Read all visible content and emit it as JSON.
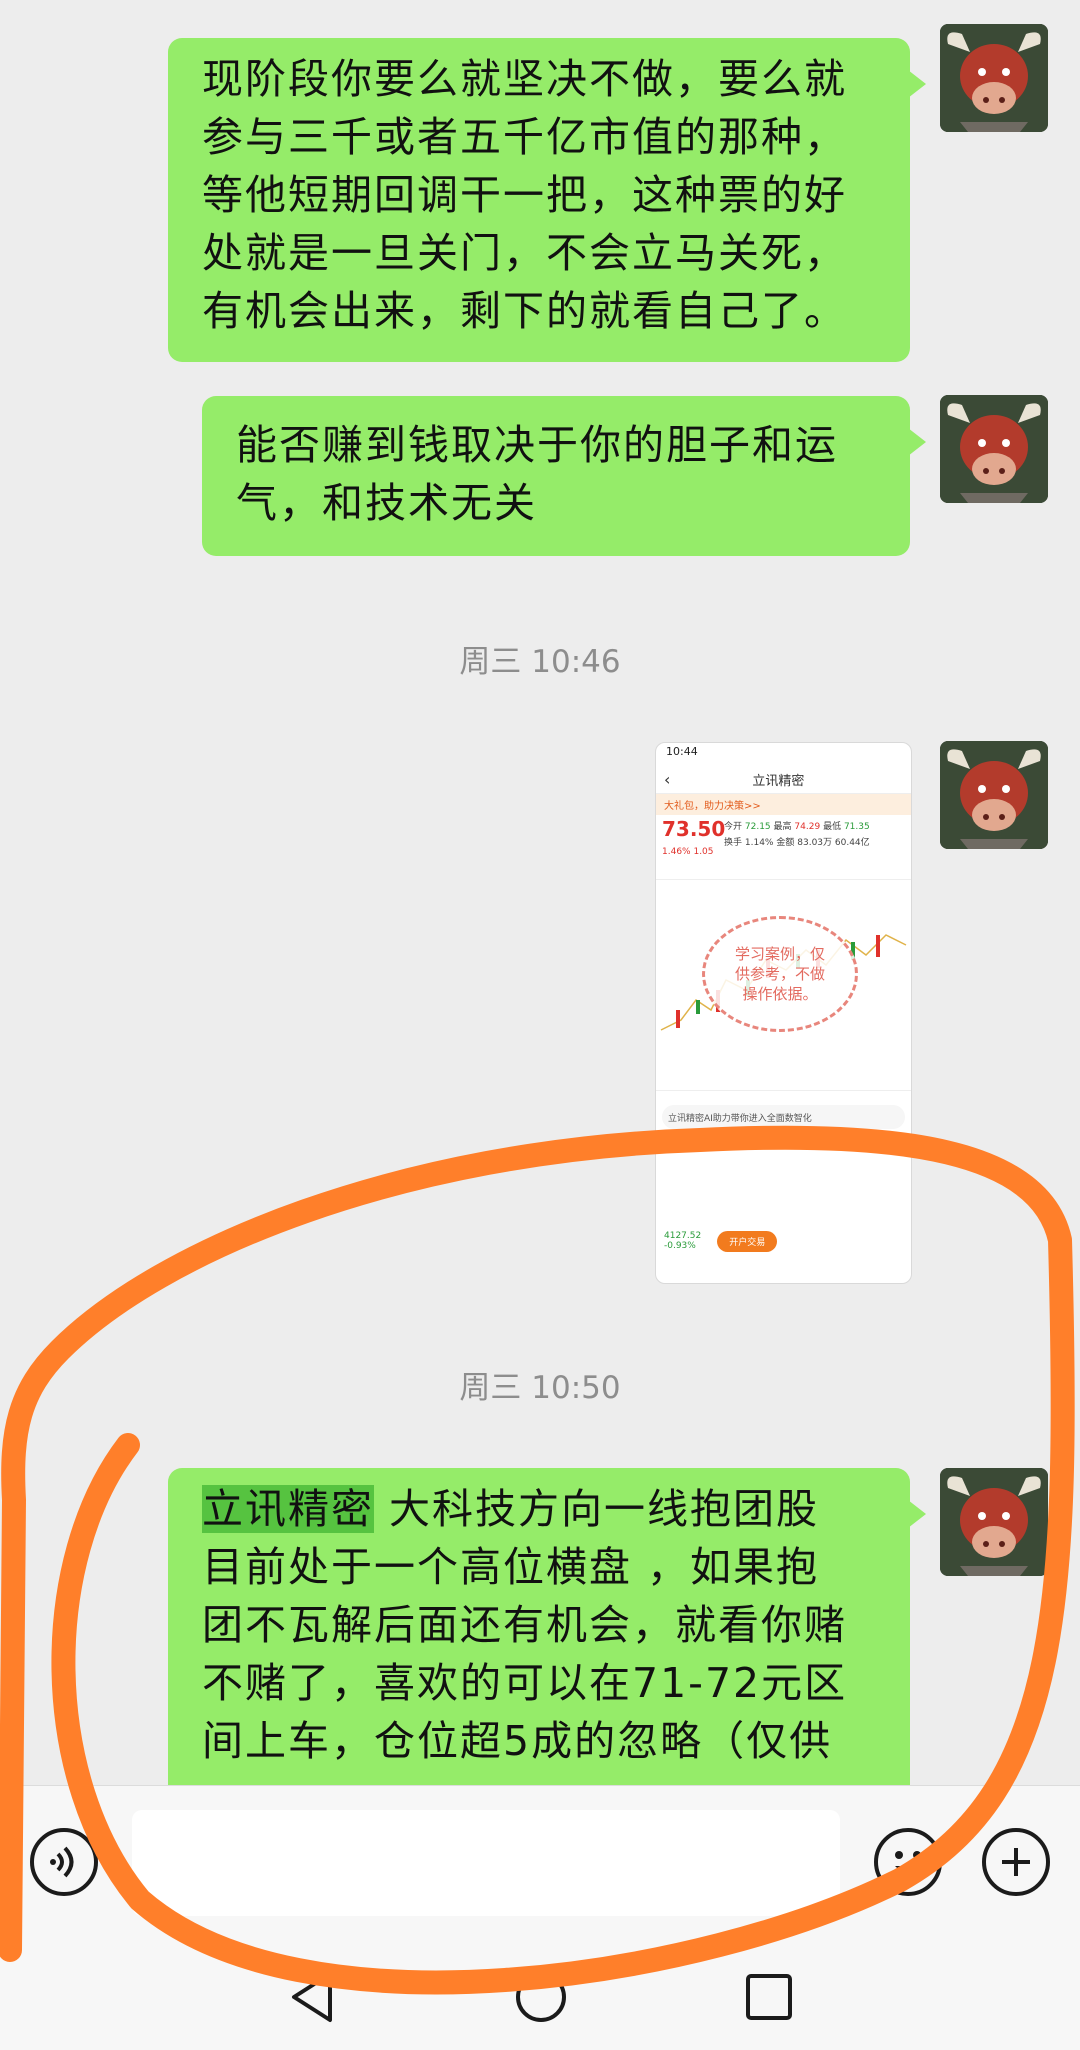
{
  "messages": [
    {
      "type": "text",
      "lines": [
        "现阶段你要么就坚决不做，要么就",
        "参与三千或者五千亿市值的那种，",
        "等他短期回调干一把，这种票的好",
        "处就是一旦关门，不会立马关死，",
        "有机会出来，剩下的就看自己了。"
      ]
    },
    {
      "type": "text",
      "lines": [
        "能否赚到钱取决于你的胆子和运",
        "气，和技术无关"
      ]
    },
    {
      "type": "time",
      "text": "周三 10:46"
    },
    {
      "type": "image",
      "screenshot": {
        "status_time": "10:44",
        "stock_name": "立讯精密",
        "banner": "大礼包，助力决策>>",
        "price": "73.50",
        "open_label": "今开",
        "open": "72.15",
        "high_label": "最高",
        "high": "74.29",
        "low_label": "最低",
        "low": "71.35",
        "change_pct": "1.46%",
        "change": "1.05",
        "turnover_label": "换手",
        "turnover": "1.14%",
        "volume_label": "金额",
        "volume": "83.03万",
        "amount": "60.44亿",
        "stamp": "学习案例，仅供参考，不做操作依据。",
        "ad": "立讯精密AI助力带你进入全面数智化",
        "index_value": "4127.52",
        "index_change": "-0.93%",
        "open_account": "开户交易"
      }
    },
    {
      "type": "time",
      "text": "周三 10:50"
    },
    {
      "type": "text",
      "highlight": "立讯精密",
      "lines": [
        "  大科技方向一线抱团股",
        "目前处于一个高位横盘 ，如果抱",
        "团不瓦解后面还有机会，就看你赌",
        "不赌了，喜欢的可以在71-72元区",
        "间上车，仓位超5成的忽略（仅供"
      ]
    }
  ],
  "input_bar": {
    "voice_icon": "voice-icon",
    "emoji_icon": "emoji-icon",
    "plus_icon": "plus-icon",
    "placeholder": ""
  },
  "nav_bar": [
    "back",
    "home",
    "recents"
  ],
  "colors": {
    "bubble": "#95ec69",
    "background": "#ededed",
    "annotation": "#ff7f2a"
  }
}
